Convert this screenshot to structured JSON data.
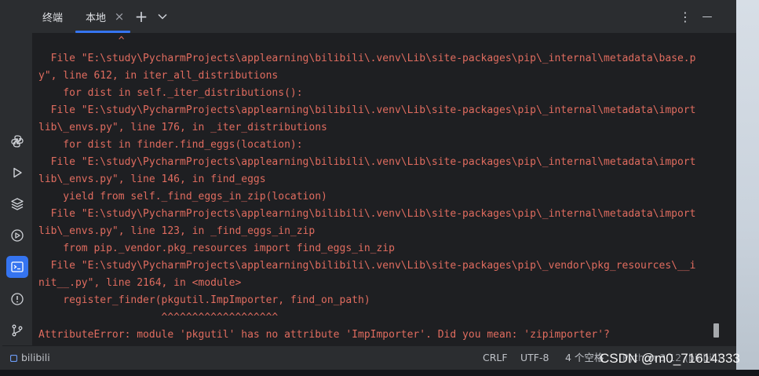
{
  "colors": {
    "accent": "#3574f0",
    "error_text": "#e06c5f",
    "panel_bg": "#2b2d30",
    "terminal_bg": "#1e1f22"
  },
  "tabs": {
    "title": "终端",
    "active_tab": "本地",
    "close_glyph": "×",
    "add_glyph": "+",
    "dropdown_glyph": "⌄",
    "more_glyph": "⋮",
    "minimize_glyph": "—"
  },
  "sidebar": {
    "icons": [
      "python-icon",
      "run-icon",
      "layers-icon",
      "services-icon",
      "terminal-icon",
      "problems-icon",
      "git-icon"
    ],
    "active": "terminal-icon"
  },
  "terminal": {
    "lines": [
      "             ^",
      "  File \"E:\\study\\PycharmProjects\\applearning\\bilibili\\.venv\\Lib\\site-packages\\pip\\_internal\\metadata\\base.p",
      "y\", line 612, in iter_all_distributions",
      "    for dist in self._iter_distributions():",
      "  File \"E:\\study\\PycharmProjects\\applearning\\bilibili\\.venv\\Lib\\site-packages\\pip\\_internal\\metadata\\import",
      "lib\\_envs.py\", line 176, in _iter_distributions",
      "    for dist in finder.find_eggs(location):",
      "  File \"E:\\study\\PycharmProjects\\applearning\\bilibili\\.venv\\Lib\\site-packages\\pip\\_internal\\metadata\\import",
      "lib\\_envs.py\", line 146, in find_eggs",
      "    yield from self._find_eggs_in_zip(location)",
      "  File \"E:\\study\\PycharmProjects\\applearning\\bilibili\\.venv\\Lib\\site-packages\\pip\\_internal\\metadata\\import",
      "lib\\_envs.py\", line 123, in _find_eggs_in_zip",
      "    from pip._vendor.pkg_resources import find_eggs_in_zip",
      "  File \"E:\\study\\PycharmProjects\\applearning\\bilibili\\.venv\\Lib\\site-packages\\pip\\_vendor\\pkg_resources\\__i",
      "nit__.py\", line 2164, in <module>",
      "    register_finder(pkgutil.ImpImporter, find_on_path)",
      "                    ^^^^^^^^^^^^^^^^^^^",
      "AttributeError: module 'pkgutil' has no attribute 'ImpImporter'. Did you mean: 'zipimporter'?"
    ]
  },
  "status_bar": {
    "project": "bilibili",
    "line_ending": "CRLF",
    "encoding": "UTF-8",
    "indent": "4 个空格",
    "interpreter": "Python 3.12 (bilibili)"
  },
  "watermark": "CSDN @m0_71614333"
}
